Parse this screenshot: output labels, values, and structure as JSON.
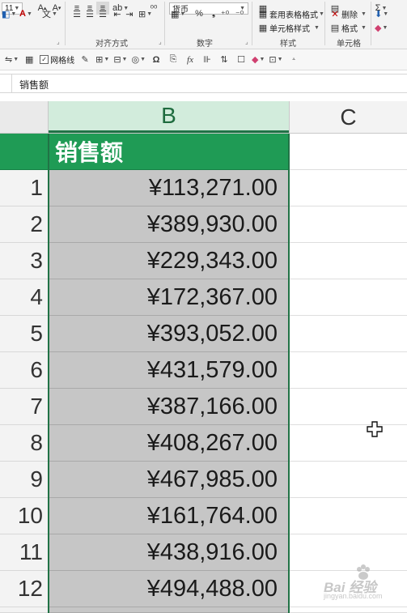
{
  "ribbon": {
    "font_size": "11",
    "number_format": "货币",
    "groups": {
      "alignment": "对齐方式",
      "number": "数字",
      "styles": "样式",
      "cells": "单元格"
    },
    "styles_items": [
      "套用表格格式",
      "单元格样式"
    ],
    "cells_items": [
      "删除",
      "格式"
    ],
    "percent_symbol": "%"
  },
  "qat": {
    "gridlines_label": "网格线"
  },
  "formula_bar": {
    "content": "销售额"
  },
  "sheet": {
    "columns": [
      "B",
      "C"
    ],
    "header_label": "销售额",
    "rows": [
      {
        "num": "1",
        "value": "¥113,271.00"
      },
      {
        "num": "2",
        "value": "¥389,930.00"
      },
      {
        "num": "3",
        "value": "¥229,343.00"
      },
      {
        "num": "4",
        "value": "¥172,367.00"
      },
      {
        "num": "5",
        "value": "¥393,052.00"
      },
      {
        "num": "6",
        "value": "¥431,579.00"
      },
      {
        "num": "7",
        "value": "¥387,166.00"
      },
      {
        "num": "8",
        "value": "¥408,267.00"
      },
      {
        "num": "9",
        "value": "¥467,985.00"
      },
      {
        "num": "10",
        "value": "¥161,764.00"
      },
      {
        "num": "11",
        "value": "¥438,916.00"
      },
      {
        "num": "12",
        "value": "¥494,488.00"
      }
    ]
  },
  "colors": {
    "header_green": "#1f9b55",
    "selection_green": "#217346",
    "selected_fill": "#c6c6c6"
  },
  "watermark": {
    "text": "Bai 经验",
    "sub": "jingyan.baidu.com"
  }
}
